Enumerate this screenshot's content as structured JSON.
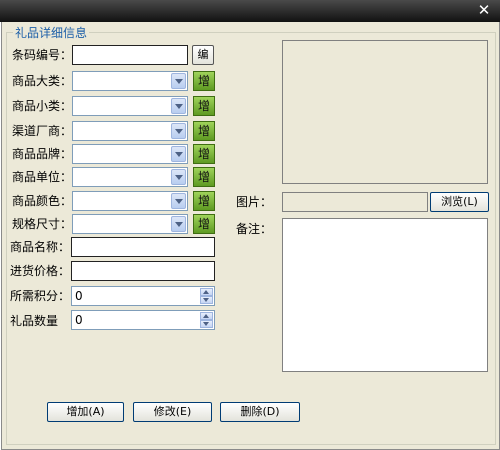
{
  "window": {
    "close_glyph": "✕"
  },
  "group": {
    "title": "礼品详细信息"
  },
  "form": {
    "barcode": {
      "label": "条码编号：",
      "value": "",
      "edit_button": "编"
    },
    "category_big": {
      "label": "商品大类：",
      "value": ""
    },
    "category_small": {
      "label": "商品小类：",
      "value": ""
    },
    "vendor": {
      "label": "渠道厂商：",
      "value": ""
    },
    "brand": {
      "label": "商品品牌：",
      "value": ""
    },
    "unit": {
      "label": "商品单位：",
      "value": ""
    },
    "color": {
      "label": "商品颜色：",
      "value": ""
    },
    "size": {
      "label": "规格尺寸：",
      "value": ""
    },
    "add_label": "增",
    "name": {
      "label": "商品名称：",
      "value": ""
    },
    "price": {
      "label": "进货价格：",
      "value": ""
    },
    "points": {
      "label": "所需积分：",
      "value": "0"
    },
    "quantity": {
      "label": "礼品数量",
      "value": "0"
    }
  },
  "image": {
    "label": "图片：",
    "path_value": "",
    "browse_button": "浏览(L)"
  },
  "remark": {
    "label": "备注：",
    "value": ""
  },
  "actions": {
    "add": "增加(A)",
    "edit": "修改(E)",
    "delete": "删除(D)"
  }
}
